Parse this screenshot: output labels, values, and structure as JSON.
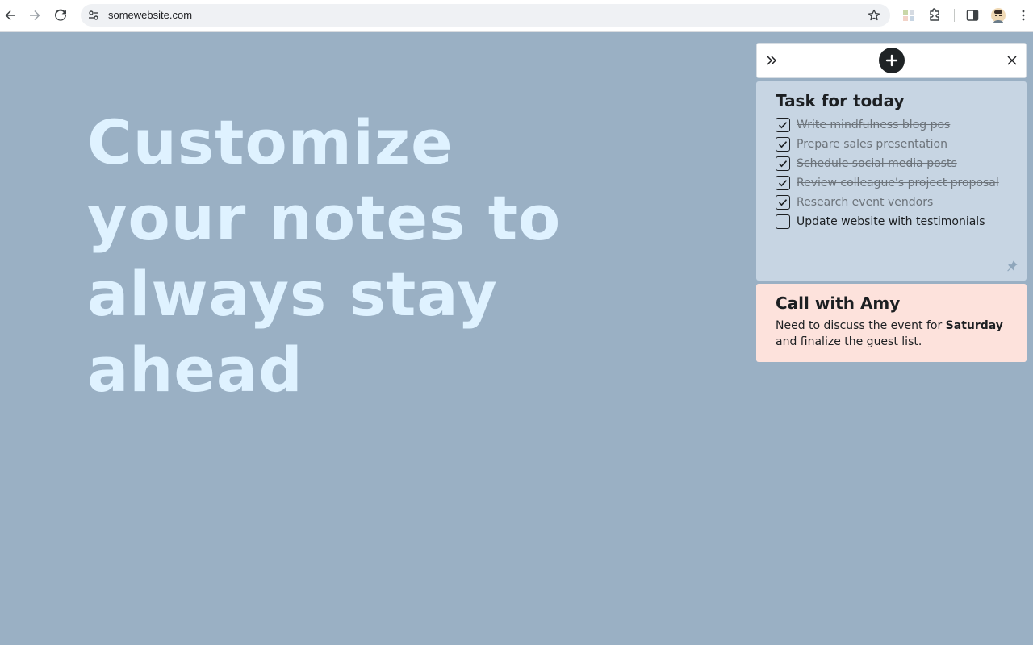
{
  "browser": {
    "url": "somewebsite.com"
  },
  "hero": {
    "line1": "Customize",
    "line2": "your notes to",
    "line3": "always stay",
    "line4": "ahead"
  },
  "panel": {
    "icons": {
      "collapse": "double-chevron-right-icon",
      "add": "plus-icon",
      "close": "close-icon"
    }
  },
  "notes": {
    "tasks": {
      "title": "Task for today",
      "items": [
        {
          "label": "Write mindfulness blog pos",
          "checked": true
        },
        {
          "label": "Prepare sales presentation",
          "checked": true
        },
        {
          "label": "Schedule social media posts",
          "checked": true
        },
        {
          "label": "Review colleague's project proposal",
          "checked": true
        },
        {
          "label": "Research event vendors",
          "checked": true
        },
        {
          "label": "Update website with testimonials",
          "checked": false
        }
      ],
      "color": "#c7d5e3"
    },
    "call": {
      "title": "Call with Amy",
      "body_pre": "Need to discuss the event for ",
      "body_bold": "Saturday",
      "body_post": " and finalize the guest list.",
      "color": "#fde2dc"
    }
  },
  "colors": {
    "background": "#9ab0c4",
    "hero_text": "#dff2ff",
    "add_button": "#1f2325"
  }
}
